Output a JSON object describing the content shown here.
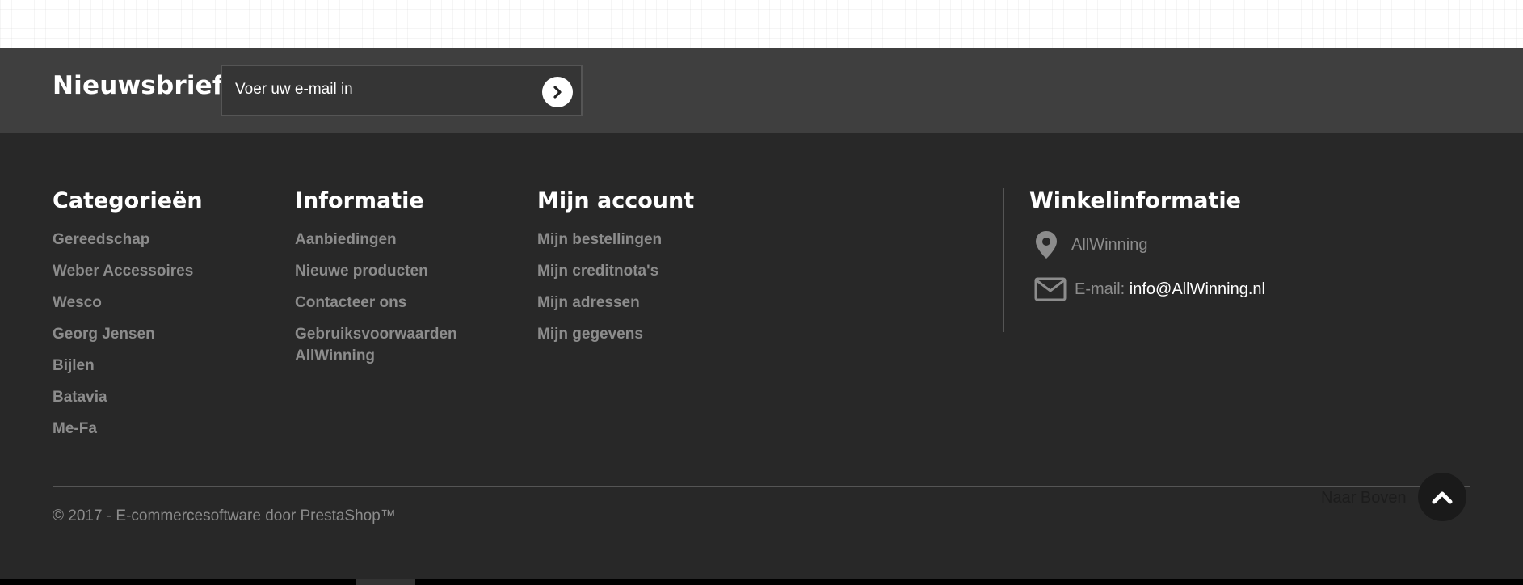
{
  "newsletter": {
    "title": "Nieuwsbrief",
    "placeholder": "Voer uw e-mail in"
  },
  "columns": [
    {
      "title": "Categorieën",
      "links": [
        "Gereedschap",
        "Weber Accessoires",
        "Wesco",
        "Georg Jensen",
        "Bijlen",
        "Batavia",
        "Me-Fa"
      ]
    },
    {
      "title": "Informatie",
      "links": [
        "Aanbiedingen",
        "Nieuwe producten",
        "Contacteer ons",
        "Gebruiksvoorwaarden AllWinning"
      ]
    },
    {
      "title": "Mijn account",
      "links": [
        "Mijn bestellingen",
        "Mijn creditnota's",
        "Mijn adressen",
        "Mijn gegevens"
      ]
    }
  ],
  "store": {
    "title": "Winkelinformatie",
    "name": "AllWinning",
    "email_label": "E-mail:",
    "email": "info@AllWinning.nl"
  },
  "footer": {
    "copyright": "© 2017 - E-commercesoftware door PrestaShop™",
    "back_to_top": "Naar Boven"
  },
  "colors": {
    "background": "#282828",
    "newsletter_bar": "#3f3f3f",
    "link": "#8c8c8c",
    "heading": "#ffffff"
  }
}
